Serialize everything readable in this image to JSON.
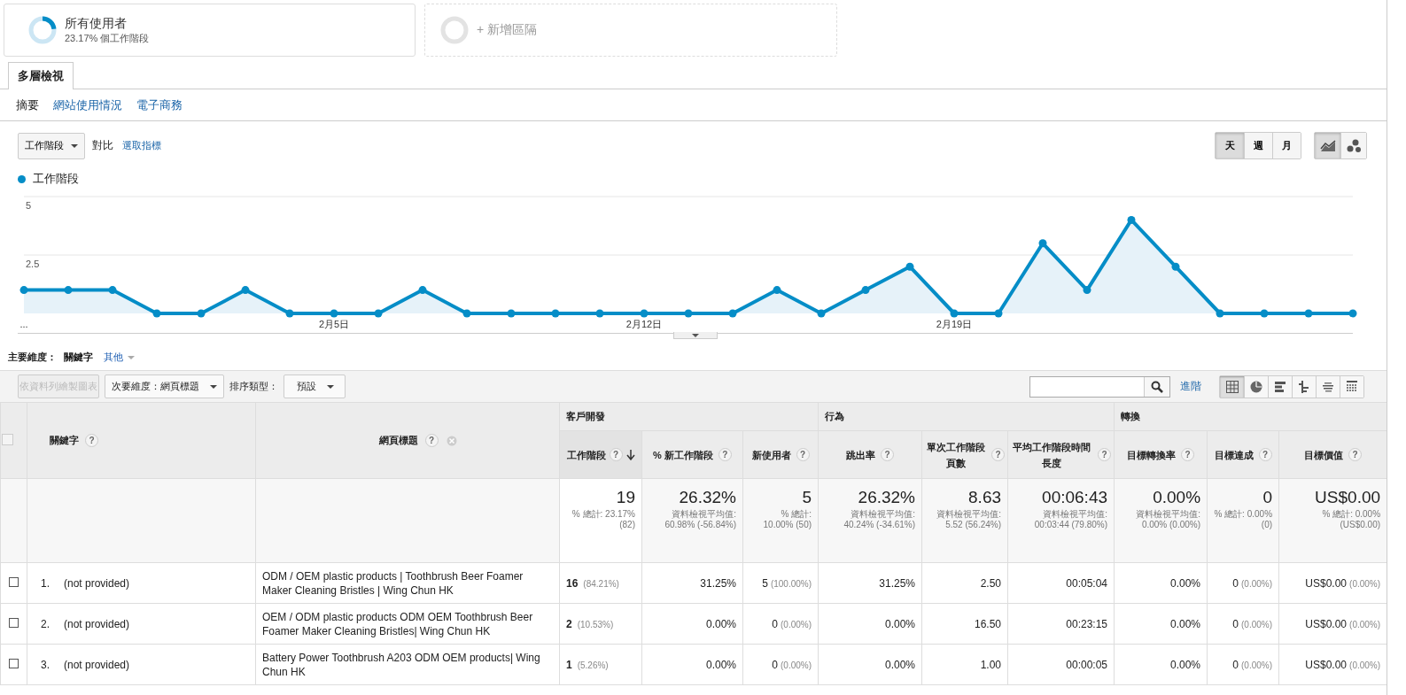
{
  "segments": [
    {
      "kind": "segment",
      "name": "所有使用者",
      "detail": "23.17% 個工作階段",
      "level": 0.2317
    },
    {
      "kind": "add",
      "name": "+ 新增區隔"
    }
  ],
  "tabs": [
    {
      "label": "多層檢視",
      "selected": true
    }
  ],
  "subnav": [
    {
      "label": "摘要",
      "selected": true
    },
    {
      "label": "網站使用情況",
      "selected": false
    },
    {
      "label": "電子商務",
      "selected": false
    }
  ],
  "chart_controls": {
    "metric": "工作階段",
    "compare": "對比",
    "pick_metric": "選取指標",
    "periods": [
      {
        "label": "天",
        "selected": true
      },
      {
        "label": "週",
        "selected": false
      },
      {
        "label": "月",
        "selected": false
      }
    ],
    "chart_types": [
      {
        "kind": "line",
        "selected": true
      },
      {
        "kind": "motion",
        "selected": false
      }
    ]
  },
  "chart_data": {
    "type": "area",
    "categories": [
      "...",
      null,
      null,
      null,
      null,
      null,
      null,
      "2月5日",
      null,
      null,
      null,
      null,
      null,
      null,
      "2月12日",
      null,
      null,
      null,
      null,
      null,
      null,
      "2月19日",
      null,
      null,
      null,
      null,
      null,
      null,
      null,
      null,
      null
    ],
    "series": [
      {
        "name": "工作階段",
        "color": "#058dc7",
        "values": [
          1,
          1,
          1,
          0,
          0,
          1,
          0,
          0,
          0,
          1,
          0,
          0,
          0,
          0,
          0,
          0,
          0,
          1,
          0,
          1,
          2,
          0,
          0,
          3,
          1,
          4,
          2,
          0,
          0,
          0,
          0
        ]
      }
    ],
    "ylim": [
      0,
      5
    ],
    "yticks": [
      {
        "value": 2.5,
        "label": "2.5"
      },
      {
        "value": 5,
        "label": "5"
      }
    ]
  },
  "dimension": {
    "label": "主要維度：",
    "options": [
      {
        "label": "關鍵字",
        "selected": true
      },
      {
        "label": "其他",
        "selected": false
      }
    ]
  },
  "toolbar": {
    "plot_rows": {
      "label": "依資料列繪製圖表",
      "disabled": true
    },
    "secondary": "次要維度：網頁標題",
    "sort_label": "排序類型：",
    "sort_value": "預設",
    "advanced": "進階",
    "views": [
      {
        "kind": "table",
        "selected": true
      },
      {
        "kind": "pie",
        "selected": false
      },
      {
        "kind": "bar",
        "selected": false
      },
      {
        "kind": "compare",
        "selected": false
      },
      {
        "kind": "terms",
        "selected": false
      },
      {
        "kind": "pivot",
        "selected": false
      }
    ]
  },
  "table": {
    "all_checked": false,
    "dimension_columns": [
      {
        "label": "關鍵字",
        "help": "?",
        "removable": false
      },
      {
        "label": "網頁標題",
        "help": "?",
        "removable": true
      }
    ],
    "groups": [
      {
        "label": "客戶開發",
        "columns": [
          {
            "label": "工作階段",
            "help": "?",
            "sorted": true
          },
          {
            "label": "% 新工作階段",
            "help": "?",
            "sorted": false
          },
          {
            "label": "新使用者",
            "help": "?",
            "sorted": false
          }
        ]
      },
      {
        "label": "行為",
        "columns": [
          {
            "label": "跳出率",
            "help": "?",
            "sorted": false
          },
          {
            "label": "單次工作階段頁數",
            "help": "?",
            "sorted": false
          },
          {
            "label": "平均工作階段時間長度",
            "help": "?",
            "sorted": false
          }
        ]
      },
      {
        "label": "轉換",
        "columns": [
          {
            "label": "目標轉換率",
            "help": "?",
            "sorted": false
          },
          {
            "label": "目標達成",
            "help": "?",
            "sorted": false
          },
          {
            "label": "目標價值",
            "help": "?",
            "sorted": false
          }
        ]
      }
    ],
    "totals": [
      {
        "value": "19",
        "note": "% 總計: 23.17% (82)"
      },
      {
        "value": "26.32%",
        "note": "資料檢視平均值: 60.98% (-56.84%)"
      },
      {
        "value": "5",
        "note": "% 總計: 10.00% (50)"
      },
      {
        "value": "26.32%",
        "note": "資料檢視平均值: 40.24% (-34.61%)"
      },
      {
        "value": "8.63",
        "note": "資料檢視平均值: 5.52 (56.24%)"
      },
      {
        "value": "00:06:43",
        "note": "資料檢視平均值: 00:03:44 (79.80%)"
      },
      {
        "value": "0.00%",
        "note": "資料檢視平均值: 0.00% (0.00%)"
      },
      {
        "value": "0",
        "note": "% 總計: 0.00% (0)"
      },
      {
        "value": "US$0.00",
        "note": "% 總計: 0.00% (US$0.00)"
      }
    ],
    "rows": [
      {
        "checked": false,
        "index": "1.",
        "keyword": "(not provided)",
        "title": "ODM / OEM plastic products | Toothbrush Beer Foamer Maker Cleaning Bristles | Wing Chun HK",
        "cells": [
          {
            "value": "16",
            "share": "(84.21%)"
          },
          {
            "value": "31.25%"
          },
          {
            "value": "5",
            "share": "(100.00%)"
          },
          {
            "value": "31.25%"
          },
          {
            "value": "2.50"
          },
          {
            "value": "00:05:04"
          },
          {
            "value": "0.00%"
          },
          {
            "value": "0",
            "share": "(0.00%)"
          },
          {
            "value": "US$0.00",
            "share": "(0.00%)"
          }
        ]
      },
      {
        "checked": false,
        "index": "2.",
        "keyword": "(not provided)",
        "title": "OEM / ODM plastic products ODM OEM Toothbrush Beer Foamer Maker Cleaning Bristles| Wing Chun HK",
        "cells": [
          {
            "value": "2",
            "share": "(10.53%)"
          },
          {
            "value": "0.00%"
          },
          {
            "value": "0",
            "share": "(0.00%)"
          },
          {
            "value": "0.00%"
          },
          {
            "value": "16.50"
          },
          {
            "value": "00:23:15"
          },
          {
            "value": "0.00%"
          },
          {
            "value": "0",
            "share": "(0.00%)"
          },
          {
            "value": "US$0.00",
            "share": "(0.00%)"
          }
        ]
      },
      {
        "checked": false,
        "index": "3.",
        "keyword": "(not provided)",
        "title": "Battery Power Toothbrush A203 ODM OEM products| Wing Chun HK",
        "cells": [
          {
            "value": "1",
            "share": "(5.26%)"
          },
          {
            "value": "0.00%"
          },
          {
            "value": "0",
            "share": "(0.00%)"
          },
          {
            "value": "0.00%"
          },
          {
            "value": "1.00"
          },
          {
            "value": "00:00:05"
          },
          {
            "value": "0.00%"
          },
          {
            "value": "0",
            "share": "(0.00%)"
          },
          {
            "value": "US$0.00",
            "share": "(0.00%)"
          }
        ]
      }
    ]
  }
}
